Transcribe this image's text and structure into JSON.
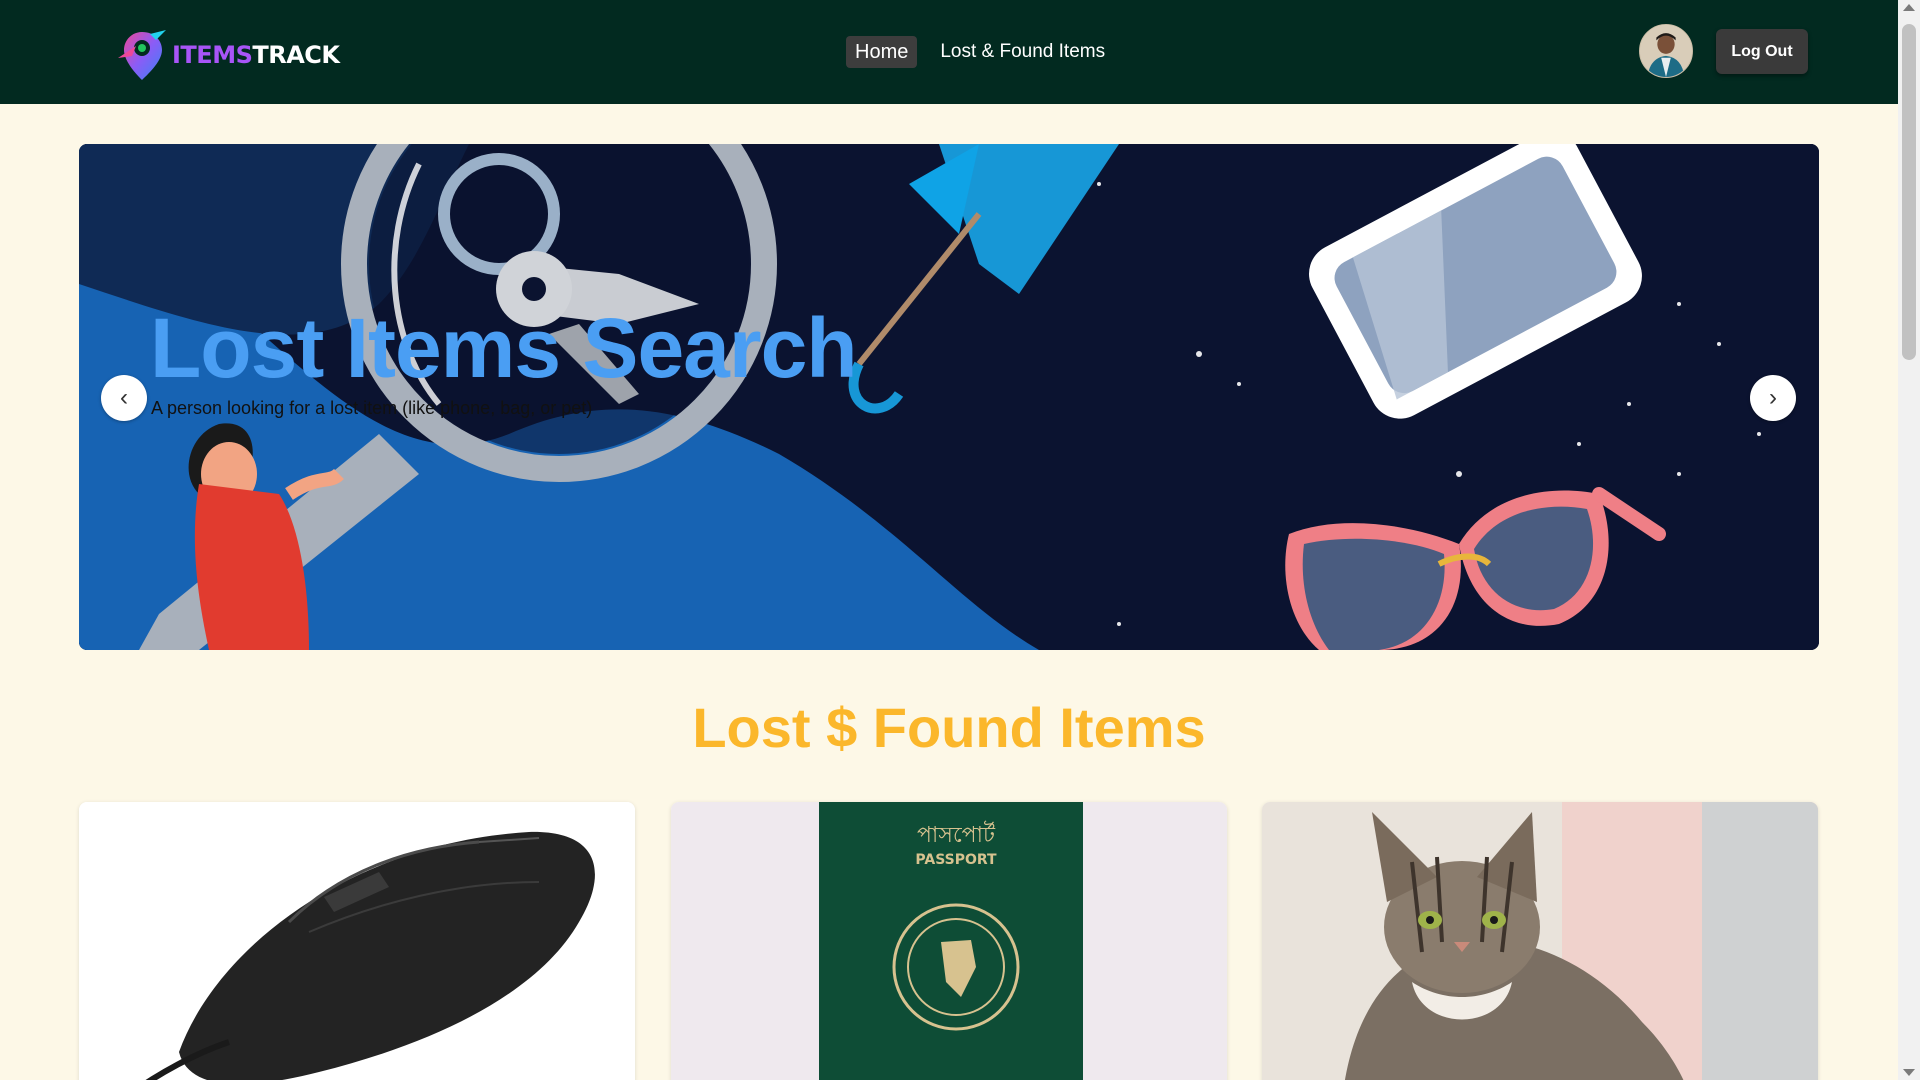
{
  "brand": {
    "name_part1": "ITEMS",
    "name_part2": "TRACK"
  },
  "nav": {
    "links": [
      {
        "label": "Home",
        "active": true
      },
      {
        "label": "Lost & Found Items",
        "active": false
      }
    ]
  },
  "user": {
    "logout_label": "Log Out"
  },
  "hero": {
    "title": "Lost Items Search",
    "caption": "A person looking for a lost item (like phone, bag, or pet)",
    "prev_icon": "‹",
    "next_icon": "›"
  },
  "section": {
    "title": "Lost $ Found Items"
  },
  "items": [
    {
      "image": "computer-mouse"
    },
    {
      "image": "passport",
      "text_bengali": "পাসপোর্ট",
      "text_english": "PASSPORT"
    },
    {
      "image": "tabby-cat"
    }
  ],
  "colors": {
    "navbar_bg": "#022a20",
    "page_bg": "#fdf8e7",
    "hero_title": "#4a9ef3",
    "section_title": "#fbb72b",
    "brand_purple": "#a855f7",
    "button_dark": "#3a3a3a"
  }
}
